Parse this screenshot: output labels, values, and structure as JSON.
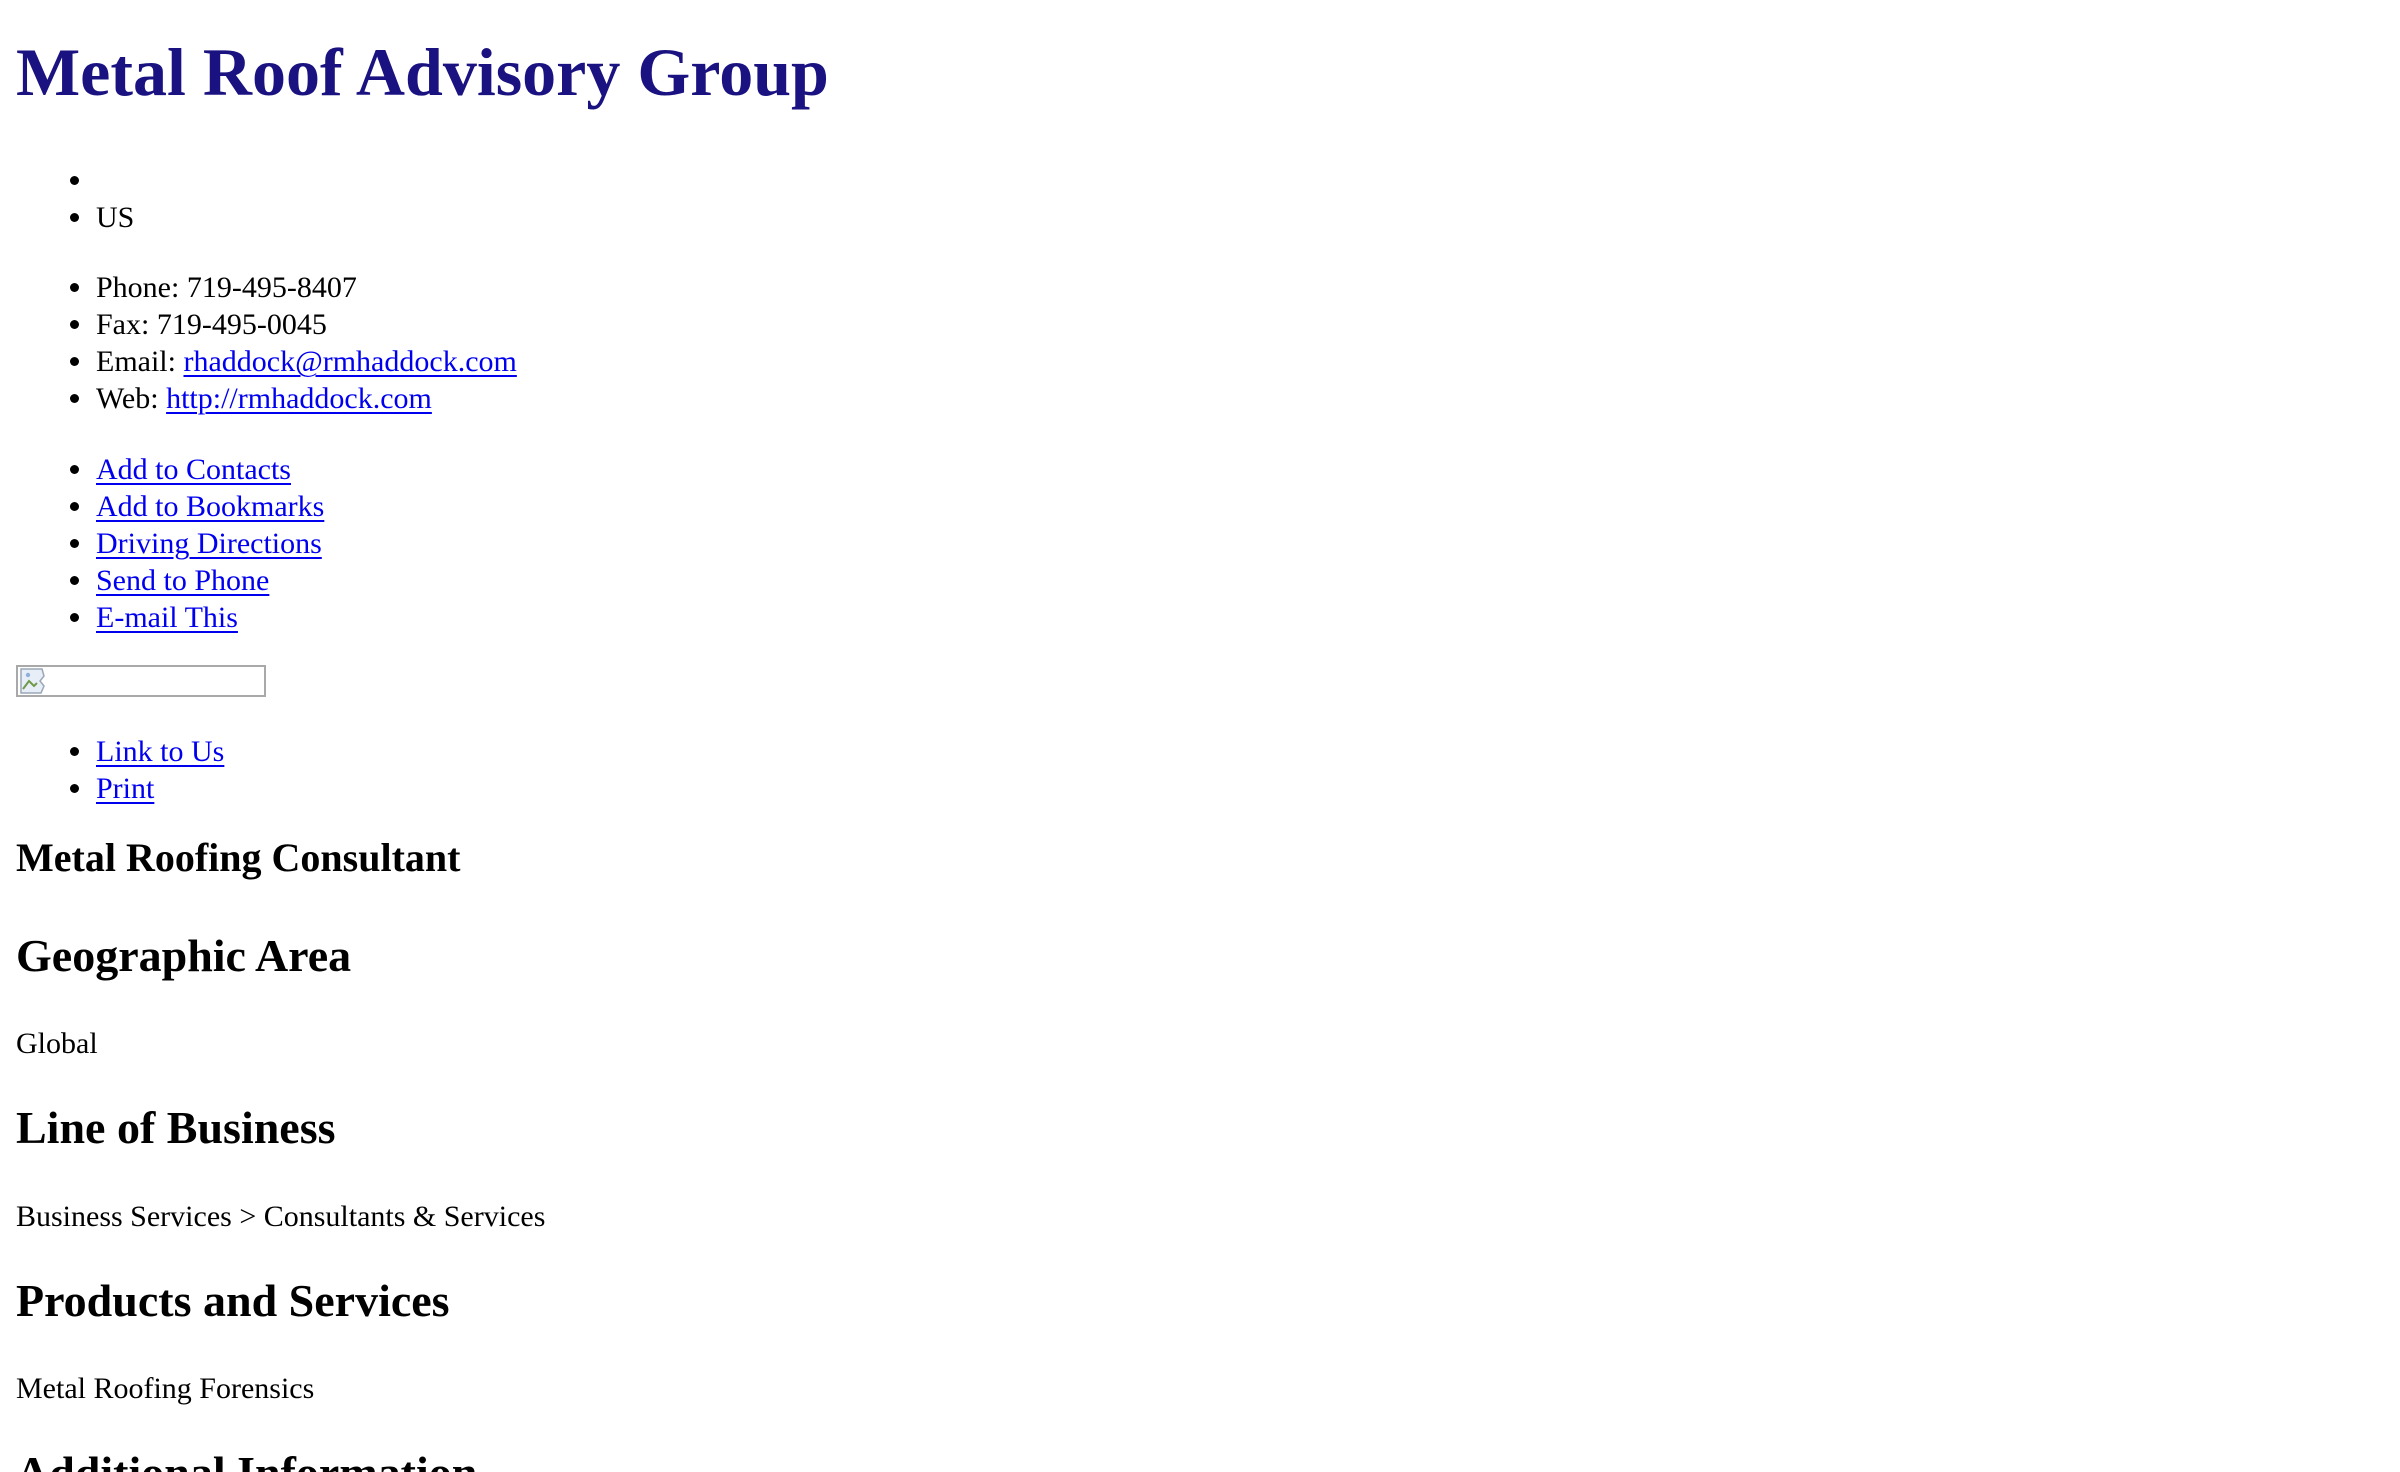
{
  "business": {
    "name": "Metal Roof Advisory Group"
  },
  "address": {
    "items": [
      "",
      "US"
    ]
  },
  "contact": {
    "phone_label": "Phone:",
    "phone": "719-495-8407",
    "fax_label": "Fax:",
    "fax": "719-495-0045",
    "email_label": "Email:",
    "email": "rhaddock@rmhaddock.com",
    "web_label": "Web:",
    "web": "http://rmhaddock.com"
  },
  "actions": {
    "add_contacts": "Add to Contacts",
    "add_bookmarks": "Add to Bookmarks",
    "driving_directions": "Driving Directions",
    "send_to_phone": "Send to Phone",
    "email_this": "E-mail This"
  },
  "secondary_actions": {
    "link_to_us": "Link to Us",
    "print": "Print"
  },
  "sections": {
    "tagline": "Metal Roofing Consultant",
    "geographic_area_heading": "Geographic Area",
    "geographic_area_value": "Global",
    "line_of_business_heading": "Line of Business",
    "line_of_business_value": "Business Services > Consultants & Services",
    "products_heading": "Products and Services",
    "products_value": "Metal Roofing Forensics",
    "additional_info_heading": "Additional Information"
  },
  "icons": {
    "broken_image": "broken-image-icon"
  }
}
